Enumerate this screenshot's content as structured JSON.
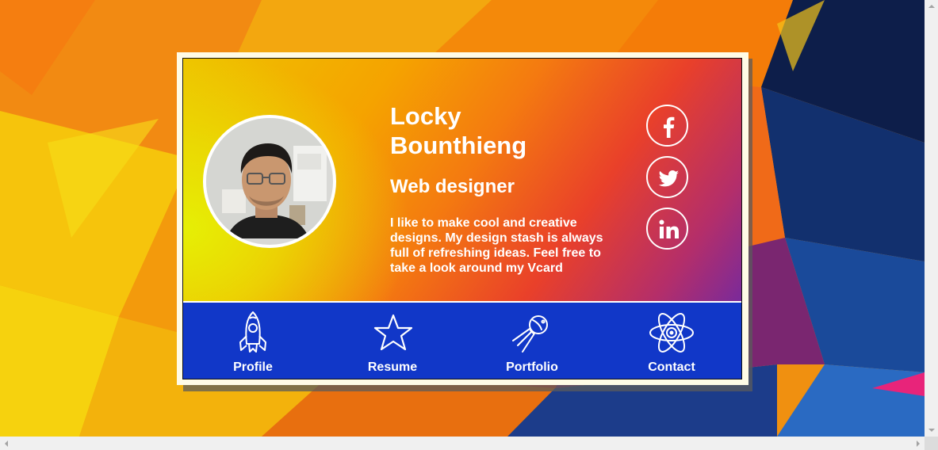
{
  "profile": {
    "name": "Locky Bounthieng",
    "role": "Web designer",
    "bio": "I like to make cool and creative designs. My design stash is always full of refreshing ideas. Feel free to take a look around my Vcard"
  },
  "social": [
    {
      "icon": "facebook-icon"
    },
    {
      "icon": "twitter-icon"
    },
    {
      "icon": "linkedin-icon"
    }
  ],
  "nav": [
    {
      "label": "Profile",
      "icon": "rocket-icon"
    },
    {
      "label": "Resume",
      "icon": "star-icon"
    },
    {
      "label": "Portfolio",
      "icon": "satellite-icon"
    },
    {
      "label": "Contact",
      "icon": "atom-icon"
    }
  ],
  "colors": {
    "nav_background": "#1137c8",
    "card_frame": "#fffbe6",
    "text": "#ffffff"
  }
}
